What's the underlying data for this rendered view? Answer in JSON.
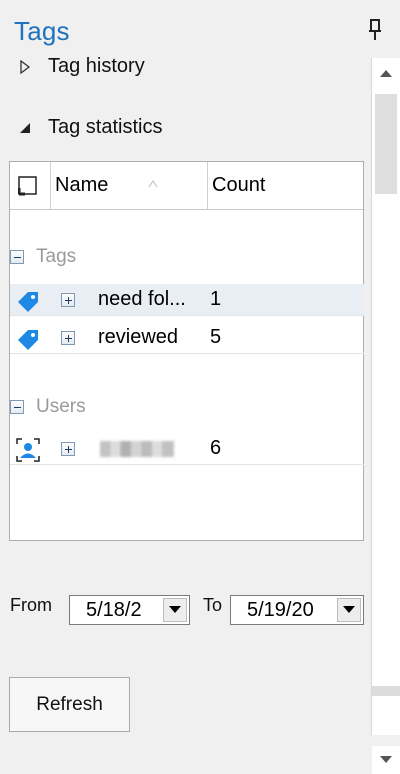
{
  "panel": {
    "title": "Tags",
    "pin_icon": "pin-icon"
  },
  "sections": {
    "history_label": "Tag history",
    "history_state": "collapsed",
    "stats_label": "Tag statistics",
    "stats_state": "expanded"
  },
  "table": {
    "columns": [
      "Name",
      "Count"
    ],
    "sort_column": "Name",
    "groups": [
      {
        "label": "Tags",
        "rows": [
          {
            "icon": "tag-icon",
            "name": "need fol...",
            "count": "1"
          },
          {
            "icon": "tag-icon",
            "name": "reviewed",
            "count": "5"
          }
        ]
      },
      {
        "label": "Users",
        "rows": [
          {
            "icon": "user-icon",
            "name": "",
            "count": "6",
            "redacted": true
          }
        ]
      }
    ]
  },
  "date_range": {
    "from_label": "From",
    "from_value": "5/18/2",
    "to_label": "To",
    "to_value": "5/19/20"
  },
  "actions": {
    "refresh_label": "Refresh"
  },
  "colors": {
    "title": "#1e73be",
    "tag_icon": "#1e88e5",
    "group_label": "#9a9a9a",
    "selected_row": "#e9eef5"
  }
}
